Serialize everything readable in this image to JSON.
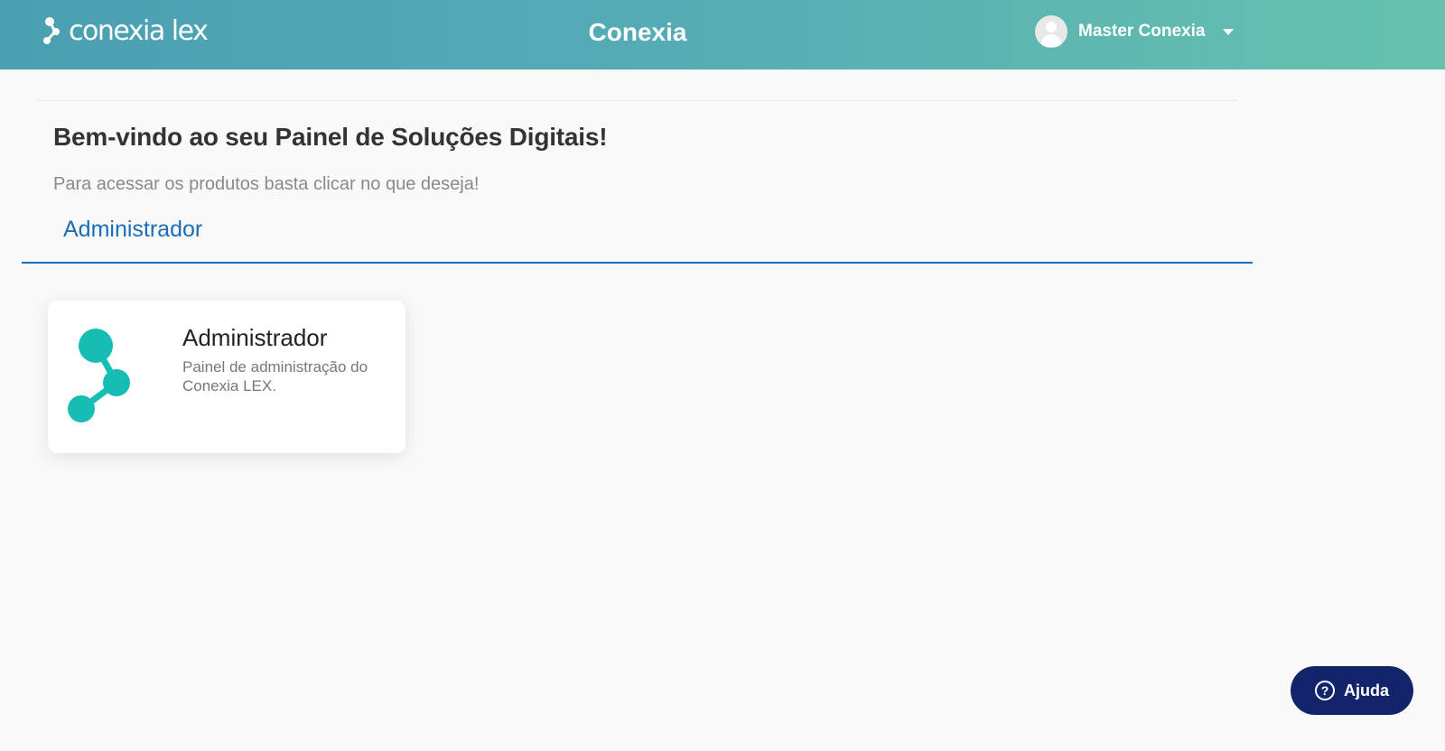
{
  "header": {
    "logo_text": "conexia lex",
    "app_title": "Conexia",
    "user_name": "Master Conexia"
  },
  "welcome": {
    "title": "Bem-vindo ao seu Painel de Soluções Digitais!",
    "subtitle": "Para acessar os produtos basta clicar no que deseja!"
  },
  "tabs": [
    {
      "label": "Administrador",
      "active": true
    }
  ],
  "cards": [
    {
      "title": "Administrador",
      "description": "Painel de administração do Conexia LEX.",
      "icon": "molecule-icon",
      "icon_color": "#16bdb5"
    }
  ],
  "help": {
    "label": "Ajuda",
    "icon_glyph": "?"
  },
  "colors": {
    "accent": "#1a6db8",
    "header_gradient_start": "#4a9fb3",
    "header_gradient_end": "#66c2ad",
    "help_button": "#13246b"
  }
}
